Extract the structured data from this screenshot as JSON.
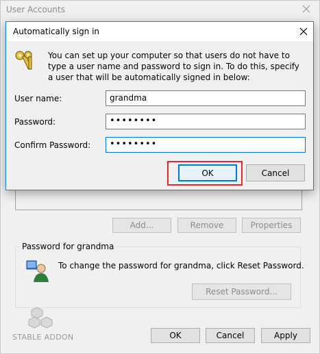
{
  "background_window": {
    "title": "User Accounts",
    "buttons": {
      "add": "Add...",
      "remove": "Remove",
      "properties": "Properties"
    },
    "password_group": {
      "title": "Password for grandma",
      "text": "To change the password for grandma, click Reset Password.",
      "reset_button": "Reset Password..."
    },
    "footer": {
      "ok": "OK",
      "cancel": "Cancel",
      "apply": "Apply"
    },
    "watermark": "STABLE ADDON"
  },
  "dialog": {
    "title": "Automatically sign in",
    "description": "You can set up your computer so that users do not have to type a user name and password to sign in. To do this, specify a user that will be automatically signed in below:",
    "fields": {
      "user_name": {
        "label": "User name:",
        "value": "grandma"
      },
      "password": {
        "label": "Password:",
        "value": "••••••••"
      },
      "confirm_password": {
        "label": "Confirm Password:",
        "value": "••••••••"
      }
    },
    "ok_label": "OK",
    "cancel_label": "Cancel"
  },
  "colors": {
    "accent": "#0078d7",
    "highlight": "#e32a2a",
    "window_bg": "#f0f0f0"
  }
}
